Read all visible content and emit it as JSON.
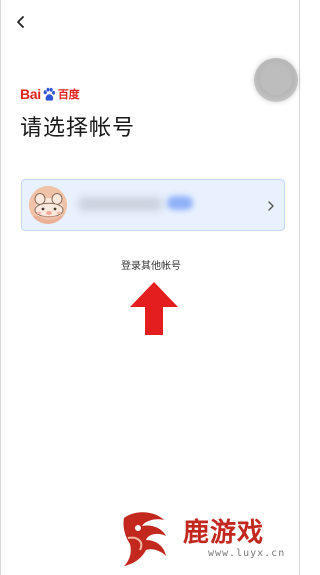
{
  "header": {
    "back_icon": "chevron-left-icon",
    "floating_button_icon": "circle-icon"
  },
  "brand": {
    "name_latin": "Bai",
    "name_cn": "百度",
    "logo_icon": "baidu-paw-icon",
    "color": "#e0231c"
  },
  "page": {
    "title": "请选择帐号"
  },
  "account_card": {
    "avatar_icon": "avatar-icon",
    "chevron_icon": "chevron-right-icon",
    "background": "#e9f1fe",
    "border": "#c4d8fb"
  },
  "actions": {
    "other_account_label": "登录其他帐号"
  },
  "annotation": {
    "arrow_icon": "red-up-arrow-icon",
    "color": "#e41e1e"
  },
  "watermark": {
    "text": "鹿游戏",
    "url": "www.luyx.cn"
  }
}
